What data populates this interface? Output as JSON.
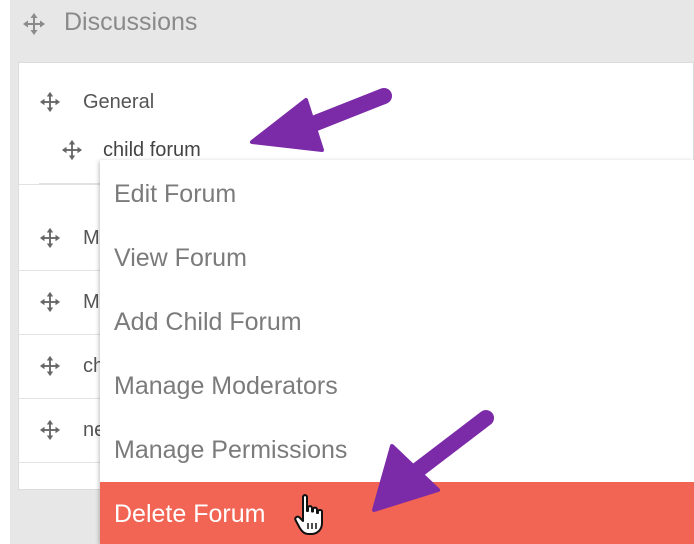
{
  "header": {
    "title": "Discussions"
  },
  "forums": [
    {
      "label": "General"
    },
    {
      "label": "child forum"
    },
    {
      "label": "M"
    },
    {
      "label": "M"
    },
    {
      "label": "ch"
    },
    {
      "label": "ne"
    }
  ],
  "context_menu": {
    "items": [
      {
        "label": "Edit Forum"
      },
      {
        "label": "View Forum"
      },
      {
        "label": "Add Child Forum"
      },
      {
        "label": "Manage Moderators"
      },
      {
        "label": "Manage Permissions"
      },
      {
        "label": "Delete Forum",
        "highlighted": true
      }
    ]
  },
  "colors": {
    "page_background": "#e7e7e7",
    "panel_background": "#ffffff",
    "danger": "#f26454",
    "arrow": "#7b2aa8",
    "muted_text": "#7b7b7b"
  },
  "icons": {
    "drag": "move-icon",
    "pointer": "hand-pointer-icon",
    "annotation": "arrow-icon"
  }
}
